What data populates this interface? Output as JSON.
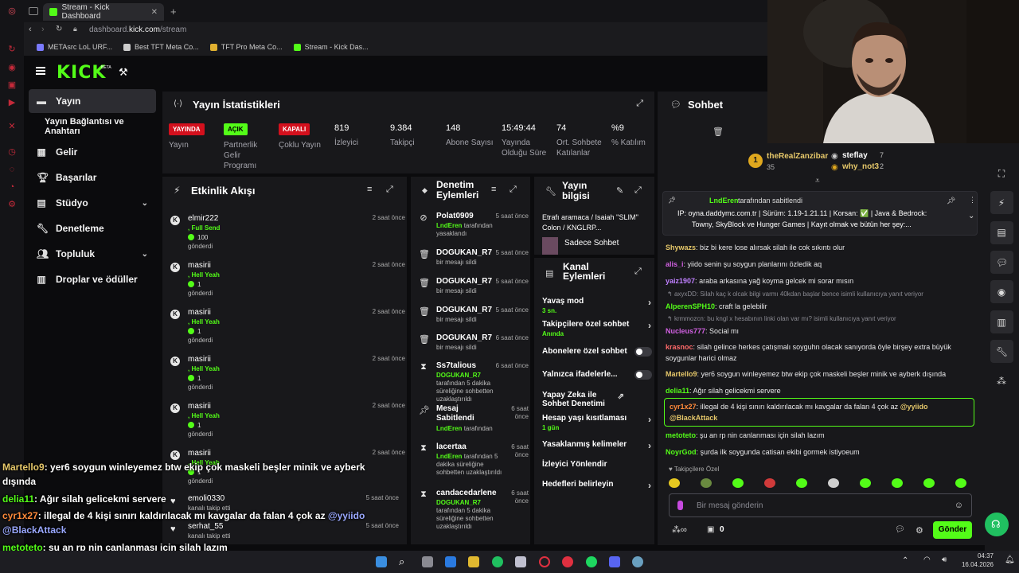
{
  "browser": {
    "tab_title": "Stream - Kick Dashboard",
    "url_host": "dashboard.",
    "url_domain": "kick.com",
    "url_path": "/stream",
    "bookmarks": [
      "METAsrc LoL URF...",
      "Best TFT Meta Co...",
      "TFT Pro Meta Co...",
      "Stream - Kick Das..."
    ]
  },
  "header": {
    "logo": "KICK",
    "logo_beta": "BETA"
  },
  "sidebar": {
    "items": [
      {
        "label": "Yayın"
      },
      {
        "label": "Yayın Bağlantısı ve Anahtarı"
      },
      {
        "label": "Gelir"
      },
      {
        "label": "Başarılar"
      },
      {
        "label": "Stüdyo"
      },
      {
        "label": "Denetleme"
      },
      {
        "label": "Topluluk"
      },
      {
        "label": "Droplar ve ödüller"
      }
    ]
  },
  "stats": {
    "title": "Yayın İstatistikleri",
    "items": [
      {
        "value": "YAYINDA",
        "label": "Yayın"
      },
      {
        "value": "AÇIK",
        "label": "Partnerlik Gelir Programı"
      },
      {
        "value": "KAPALI",
        "label": "Çoklu Yayın"
      },
      {
        "value": "819",
        "label": "İzleyici"
      },
      {
        "value": "9.384",
        "label": "Takipçi"
      },
      {
        "value": "148",
        "label": "Abone Sayısı"
      },
      {
        "value": "15:49:44",
        "label": "Yayında Olduğu Süre"
      },
      {
        "value": "74",
        "label": "Ort. Sohbete Katılanlar"
      },
      {
        "value": "%9",
        "label": "% Katılım"
      }
    ]
  },
  "activity": {
    "title": "Etkinlik Akışı",
    "events": [
      {
        "name": "elmir222",
        "sub": ", Full Send",
        "count": "100",
        "action": "gönderdi",
        "time": "2 saat önce"
      },
      {
        "name": "masirii",
        "sub": ", Hell Yeah",
        "count": "1",
        "action": "gönderdi",
        "time": "2 saat önce"
      },
      {
        "name": "masirii",
        "sub": ", Hell Yeah",
        "count": "1",
        "action": "gönderdi",
        "time": "2 saat önce"
      },
      {
        "name": "masirii",
        "sub": ", Hell Yeah",
        "count": "1",
        "action": "gönderdi",
        "time": "2 saat önce"
      },
      {
        "name": "masirii",
        "sub": ", Hell Yeah",
        "count": "1",
        "action": "gönderdi",
        "time": "2 saat önce"
      },
      {
        "name": "masirii",
        "sub": ", Hell Yeah",
        "count": "1",
        "action": "gönderdi",
        "time": "2 saat önce"
      }
    ],
    "follows": [
      {
        "name": "emoli0330",
        "action": "kanalı takip etti",
        "time": "5 saat önce"
      },
      {
        "name": "serhat_55",
        "action": "kanalı takip etti",
        "time": "5 saat önce"
      }
    ]
  },
  "moderation": {
    "title": "Denetim Eylemleri",
    "items": [
      {
        "name": "Polat0909",
        "actor": "LndEren",
        "desc": "tarafından yasaklandı",
        "time": "5 saat önce"
      },
      {
        "name": "DOGUKAN_R7",
        "actor": "",
        "desc": "bir mesajı sildi",
        "time": "5 saat önce"
      },
      {
        "name": "DOGUKAN_R7",
        "actor": "",
        "desc": "bir mesajı sildi",
        "time": "5 saat önce"
      },
      {
        "name": "DOGUKAN_R7",
        "actor": "",
        "desc": "bir mesajı sildi",
        "time": "5 saat önce"
      },
      {
        "name": "DOGUKAN_R7",
        "actor": "",
        "desc": "bir mesajı sildi",
        "time": "6 saat önce"
      },
      {
        "name": "Ss7talious",
        "actor": "DOGUKAN_R7",
        "desc": "tarafından 5 dakika süreliğine sohbetten uzaklaştırıldı",
        "time": "6 saat önce"
      },
      {
        "name": "Mesaj Sabitlendi",
        "actor": "LndEren",
        "desc": "tarafından",
        "time": "6 saat önce"
      },
      {
        "name": "lacertaa",
        "actor": "LndEren",
        "desc": "tarafından 5 dakika süreliğine sohbetten uzaklaştırıldı",
        "time": "6 saat önce"
      },
      {
        "name": "candacedarlene",
        "actor": "DOGUKAN_R7",
        "desc": "tarafından 5 dakika süreliğine sohbetten uzaklaştırıldı",
        "time": "6 saat önce"
      }
    ]
  },
  "stream_info": {
    "title": "Yayın bilgisi",
    "stream_title": "Etrafı aramaca / Isaiah ''SLIM'' Colon / KNGLRP...",
    "category": "Sadece Sohbet"
  },
  "channel_actions": {
    "title": "Kanal Eylemleri",
    "items": [
      {
        "label": "Yavaş mod",
        "sub": "3 sn.",
        "control": "arrow"
      },
      {
        "label": "Takipçilere özel sohbet",
        "sub": "Anında",
        "control": "arrow"
      },
      {
        "label": "Abonelere özel sohbet",
        "sub": "",
        "control": "toggle"
      },
      {
        "label": "Yalnızca ifadelerle...",
        "sub": "",
        "control": "toggle"
      },
      {
        "label": "Yapay Zeka ile Sohbet Denetimi",
        "sub": "",
        "control": "external"
      },
      {
        "label": "Hesap yaşı kısıtlaması",
        "sub": "1 gün",
        "control": "arrow"
      },
      {
        "label": "Yasaklanmış kelimeler",
        "sub": "",
        "control": "arrow"
      },
      {
        "label": "İzleyici Yönlendir",
        "sub": "",
        "control": "none"
      },
      {
        "label": "Hedefleri belirleyin",
        "sub": "",
        "control": "arrow"
      }
    ]
  },
  "chat": {
    "title": "Sohbet",
    "leaderboard": [
      {
        "rank": "1",
        "name": "theRealZanzibar",
        "value": "35"
      },
      {
        "rank": "",
        "name": "steflay",
        "value": "7"
      },
      {
        "rank": "",
        "name": "why_not3",
        "value": "2"
      }
    ],
    "pinned": {
      "author": "LndEren",
      "label": "tarafından sabitlendi",
      "line1": "IP: oyna.daddymc.com.tr | Sürüm: 1.19-1.21.11 | Korsan: ✅ | Java & Bedrock:",
      "line2": "Towny, SkyBlock ve Hunger Games | Kayıt olmak ve bütün her şey:..."
    },
    "messages": [
      {
        "user": "Shywazs",
        "color": "#e6c86a",
        "text": "biz bi kere lose alırsak silah ile cok sıkıntı olur"
      },
      {
        "user": "alis_i",
        "color": "#d060e0",
        "text": "yiido senin şu soygun planlarını özledik aq"
      },
      {
        "user": "yaiz1907",
        "color": "#c080ff",
        "text": "araba arkasına yağ koyma gelcek mi sorar mısın"
      },
      {
        "user": "AlperenSPH10",
        "color": "#53fc18",
        "text": "craft la gelebilir",
        "reply": "axyxDD: Silah kaç k olcak bilgi varmı 40kdan başlar bence isimli kullanıcıya yanıt veriyor"
      },
      {
        "user": "Nucleus777",
        "color": "#d060e0",
        "text": "Social mı",
        "reply": "krmmozcn: bu kngl x hesabının linki olan var mı? isimli kullanıcıya yanıt veriyor"
      },
      {
        "user": "krasnoc",
        "color": "#ff6a6a",
        "text": "silah gelince herkes çatışmalı soyguhn olacak sanıyorda öyle birşey extra büyük soygunlar harici olmaz"
      },
      {
        "user": "Martello9",
        "color": "#e6c86a",
        "text": "yer6 soygun winleyemez btw ekip çok maskeli beşler minik ve ayberk dışında"
      },
      {
        "user": "delia11",
        "color": "#53fc18",
        "text": "Ağır silah gelicekmi servere"
      },
      {
        "user": "cyr1x27",
        "color": "#ff8a3a",
        "text": "illegal de 4 kişi sınırı kaldırılacak mı kavgalar da falan 4 çok az",
        "mention": "@yyiido @BlackAttack"
      },
      {
        "user": "metoteto",
        "color": "#53fc18",
        "text": "şu an rp nin canlanması için silah lazım"
      },
      {
        "user": "NoyrGod",
        "color": "#53fc18",
        "text": "şurda ilk soygunda catisan ekibi gormek istiyoeum"
      }
    ],
    "follower_label": "Takipçilere Özel",
    "input_placeholder": "Bir mesaj gönderin",
    "count": "0",
    "send_label": "Gönder"
  },
  "overlay": [
    {
      "user": "Martello9",
      "color": "#e6c86a",
      "text": ": yer6 soygun winleyemez btw ekip çok maskeli beşler minik ve ayberk",
      "cont": "dışında"
    },
    {
      "user": "delia11",
      "color": "#53fc18",
      "text": ": Ağır silah gelicekmi servere",
      "cont": ""
    },
    {
      "user": "cyr1x27",
      "color": "#ff8a3a",
      "text": ": illegal de 4 kişi sınırı kaldırılacak mı kavgalar da falan 4 çok az ",
      "mention": "@yyiido",
      "cont": "@BlackAttack"
    },
    {
      "user": "metoteto",
      "color": "#53fc18",
      "text": ": şu an rp nin canlanması için silah lazım",
      "cont": ""
    },
    {
      "user": "NoyrGod",
      "color": "#53fc18",
      "text": ": şurda ilk soygunda catisan ekibi gormek istiyoeum",
      "cont": ""
    }
  ],
  "taskbar": {
    "time": "04:37",
    "date": "16.04.2026"
  },
  "colors": {
    "kick_green": "#53fc18",
    "panel": "#18181b",
    "background": "#0b0b0d",
    "live_red": "#d3101d"
  }
}
